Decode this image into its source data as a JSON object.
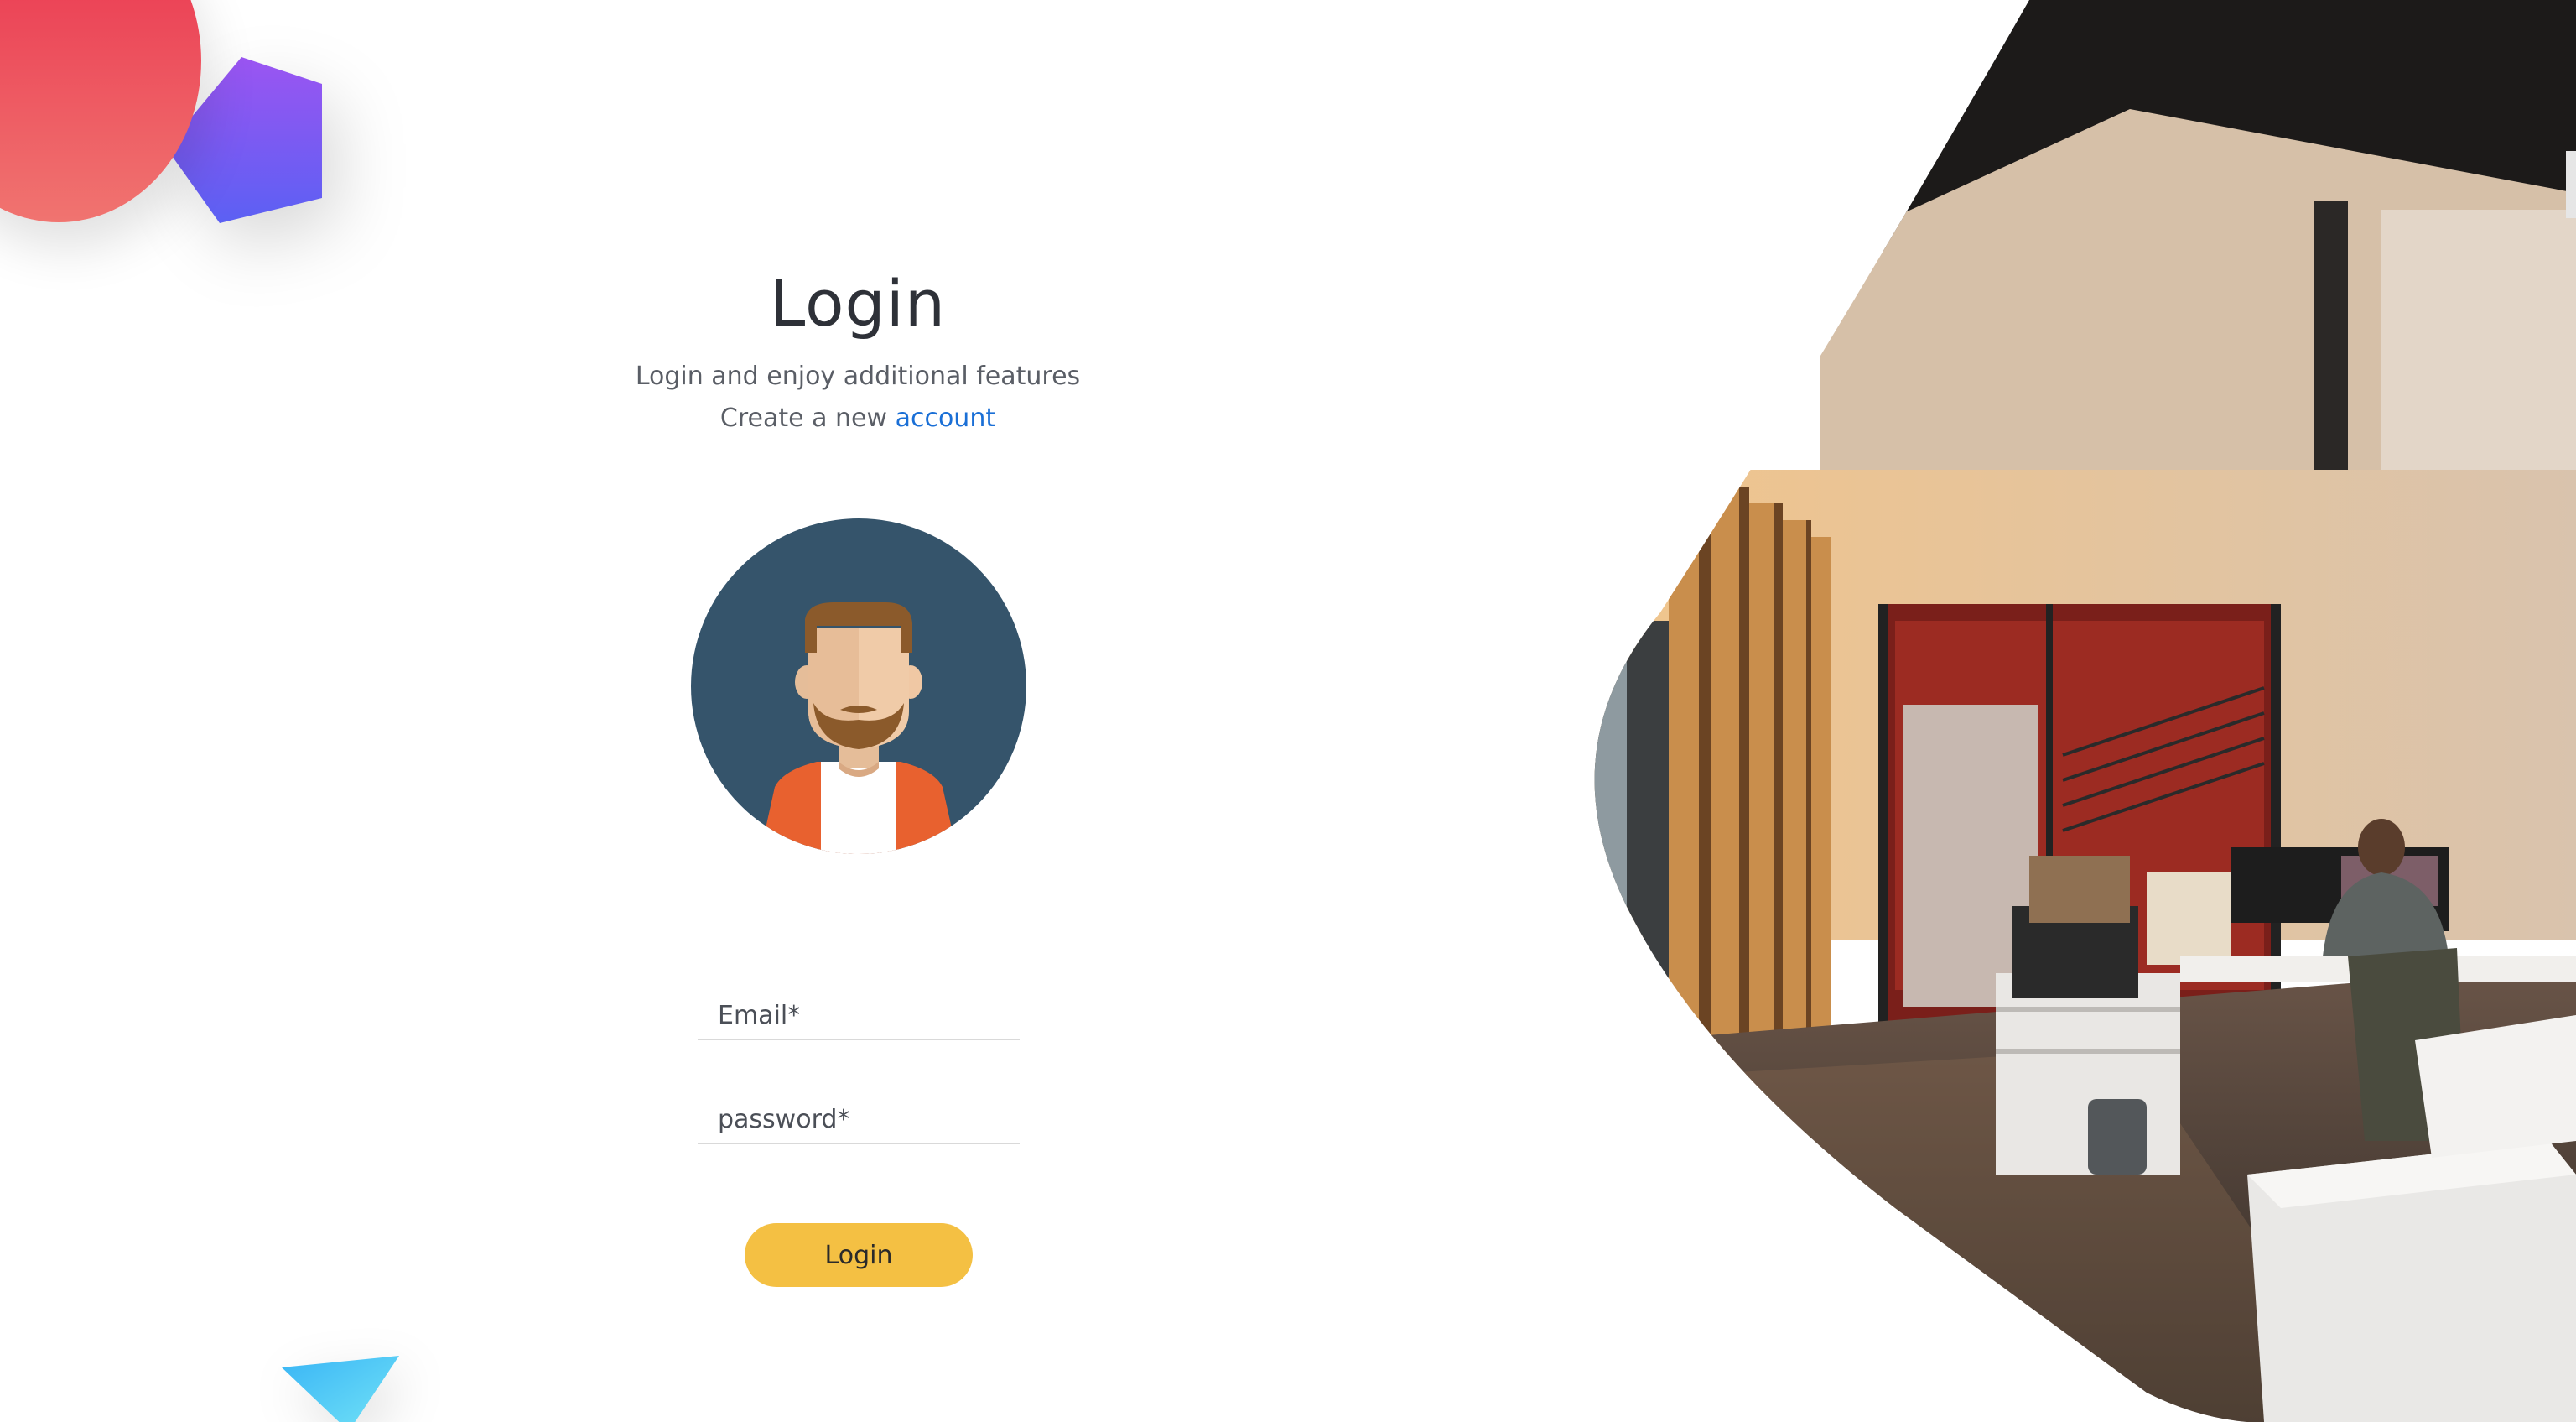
{
  "page": {
    "title": "Login",
    "subtitle": "Login and enjoy additional features",
    "create_prefix": "Create a new ",
    "create_link": "account"
  },
  "form": {
    "email_placeholder": "Email*",
    "password_placeholder": "password*",
    "login_label": "Login"
  },
  "colors": {
    "accent_button": "#f4c043",
    "link": "#1a6fd6",
    "avatar_bg": "#35546b",
    "deco_red": "#ea2f4c",
    "deco_purple": "#8a52f0",
    "deco_cyan": "#5fd3f5"
  },
  "icons": {
    "avatar": "user-avatar-icon",
    "hero": "office-photo"
  }
}
